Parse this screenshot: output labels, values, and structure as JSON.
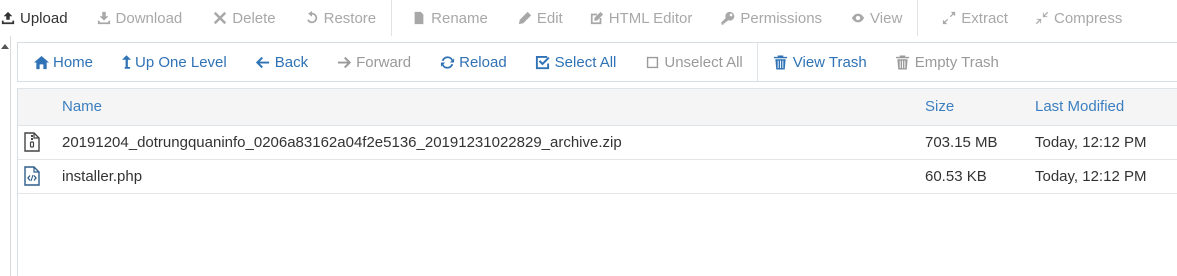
{
  "toolbar": {
    "upload": "Upload",
    "download": "Download",
    "delete": "Delete",
    "restore": "Restore",
    "rename": "Rename",
    "edit": "Edit",
    "html_editor": "HTML Editor",
    "permissions": "Permissions",
    "view": "View",
    "extract": "Extract",
    "compress": "Compress"
  },
  "nav": {
    "home": "Home",
    "up_one_level": "Up One Level",
    "back": "Back",
    "forward": "Forward",
    "reload": "Reload",
    "select_all": "Select All",
    "unselect_all": "Unselect All",
    "view_trash": "View Trash",
    "empty_trash": "Empty Trash"
  },
  "table": {
    "columns": {
      "name": "Name",
      "size": "Size",
      "modified": "Last Modified"
    },
    "rows": [
      {
        "icon": "zip-file-icon",
        "name": "20191204_dotrungquaninfo_0206a83162a04f2e5136_20191231022829_archive.zip",
        "size": "703.15 MB",
        "modified": "Today, 12:12 PM"
      },
      {
        "icon": "code-file-icon",
        "name": "installer.php",
        "size": "60.53 KB",
        "modified": "Today, 12:12 PM"
      }
    ]
  },
  "colors": {
    "link": "#2f72b5",
    "disabled": "#a8a8a8",
    "header_bg": "#f5f5f5"
  }
}
